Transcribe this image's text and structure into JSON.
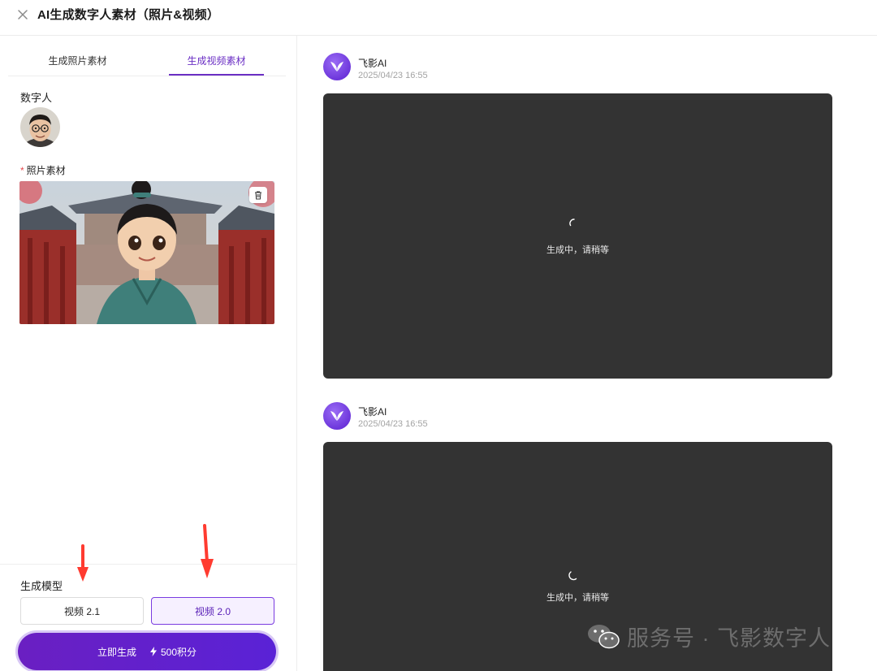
{
  "header": {
    "title": "AI生成数字人素材（照片&视频）"
  },
  "left_panel": {
    "tabs": [
      {
        "label": "生成照片素材",
        "active": false
      },
      {
        "label": "生成视频素材",
        "active": true
      }
    ],
    "digital_human_label": "数字人",
    "photo_material_required_mark": "*",
    "photo_material_label": "照片素材",
    "model_label": "生成模型",
    "models": [
      {
        "label": "视频 2.1",
        "selected": false
      },
      {
        "label": "视频 2.0",
        "selected": true
      }
    ],
    "generate_button": {
      "label": "立即生成",
      "cost": "500积分"
    }
  },
  "messages": [
    {
      "sender": "飞影AI",
      "time": "2025/04/23 16:55",
      "status_text": "生成中，请稍等"
    },
    {
      "sender": "飞影AI",
      "time": "2025/04/23 16:55",
      "status_text": "生成中，请稍等"
    }
  ],
  "watermark": {
    "text": "服务号 · 飞影数字人"
  },
  "colors": {
    "accent": "#6b2fc4",
    "generate_gradient_start": "#6a1fc2",
    "generate_gradient_end": "#5a22d6",
    "video_placeholder": "#333333",
    "annotation_arrow": "#ff3b30"
  }
}
